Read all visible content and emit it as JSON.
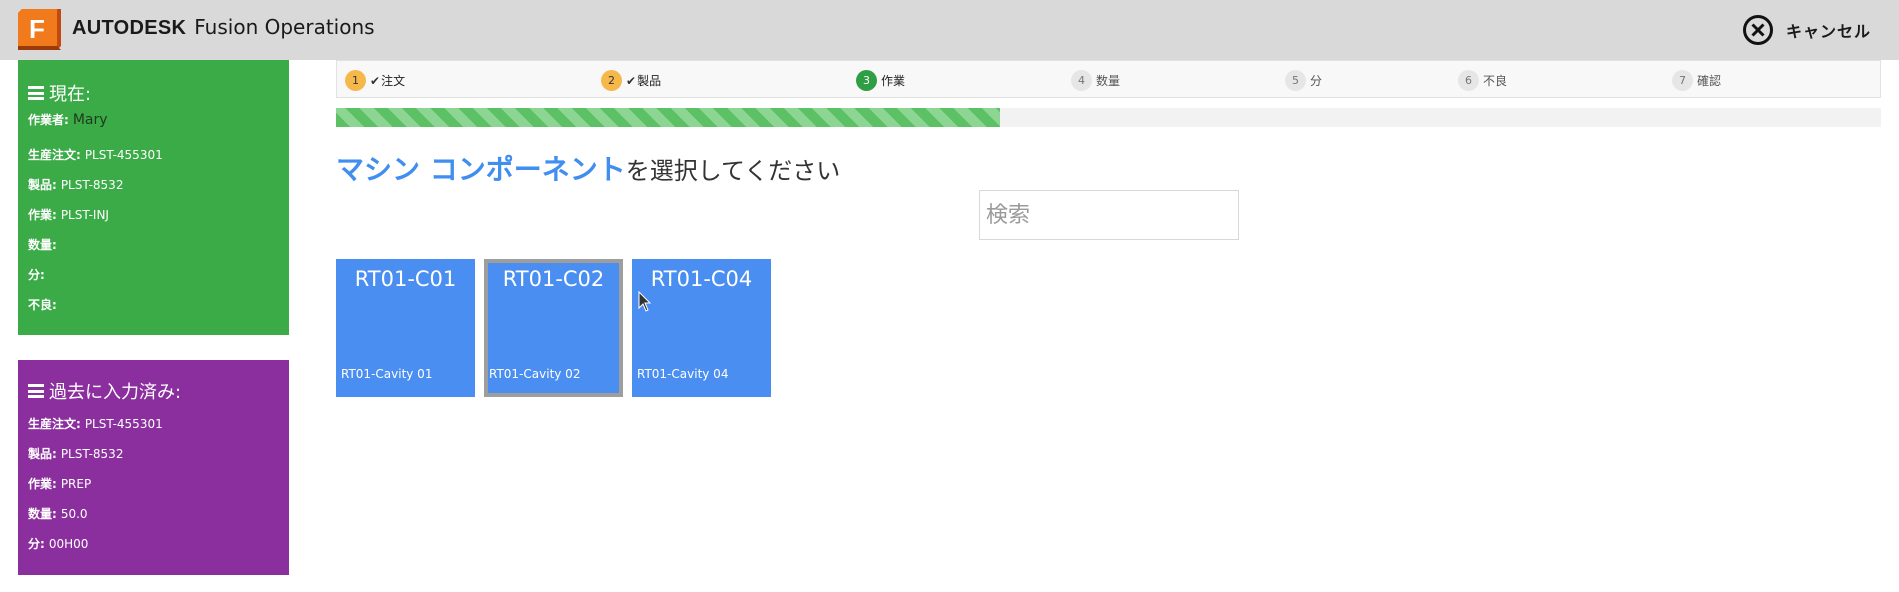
{
  "header": {
    "logo_letter": "F",
    "brand_bold": "AUTODESK",
    "brand_product": "Fusion Operations",
    "cancel_label": "キャンセル"
  },
  "current_panel": {
    "title": "現在:",
    "rows": [
      {
        "label": "作業者:",
        "value": "Mary"
      },
      {
        "label": "生産注文:",
        "value": "PLST-455301"
      },
      {
        "label": "製品:",
        "value": "PLST-8532"
      },
      {
        "label": "作業:",
        "value": "PLST-INJ"
      },
      {
        "label": "数量:",
        "value": ""
      },
      {
        "label": "分:",
        "value": ""
      },
      {
        "label": "不良:",
        "value": ""
      }
    ]
  },
  "past_panel": {
    "title": "過去に入力済み:",
    "rows": [
      {
        "label": "生産注文:",
        "value": "PLST-455301"
      },
      {
        "label": "製品:",
        "value": "PLST-8532"
      },
      {
        "label": "作業:",
        "value": "PREP"
      },
      {
        "label": "数量:",
        "value": "50.0"
      },
      {
        "label": "分:",
        "value": "00H00"
      }
    ]
  },
  "steps": [
    {
      "num": "1",
      "label": "注文",
      "state": "done"
    },
    {
      "num": "2",
      "label": "製品",
      "state": "done"
    },
    {
      "num": "3",
      "label": "作業",
      "state": "active"
    },
    {
      "num": "4",
      "label": "数量",
      "state": "todo"
    },
    {
      "num": "5",
      "label": "分",
      "state": "todo"
    },
    {
      "num": "6",
      "label": "不良",
      "state": "todo"
    },
    {
      "num": "7",
      "label": "確認",
      "state": "todo"
    }
  ],
  "progress": {
    "fraction": 0.43
  },
  "heading": {
    "accent": "マシン コンポーネント",
    "rest": "を選択してください"
  },
  "search": {
    "placeholder": "検索"
  },
  "components": [
    {
      "code": "RT01-C01",
      "desc": "RT01-Cavity 01",
      "selected": false
    },
    {
      "code": "RT01-C02",
      "desc": "RT01-Cavity 02",
      "selected": true
    },
    {
      "code": "RT01-C04",
      "desc": "RT01-Cavity 04",
      "selected": false
    }
  ],
  "colors": {
    "current_panel": "#3aab47",
    "past_panel": "#8c2f9e",
    "tile": "#4a8ef2",
    "accent_text": "#3f8ef0",
    "step_done": "#f7b84b",
    "step_active": "#2f9e44"
  },
  "icons": {
    "logo": "fusion-logo-icon",
    "cancel": "close-circle-icon",
    "panel_menu": "hamburger-icon",
    "step_check": "check-icon"
  }
}
